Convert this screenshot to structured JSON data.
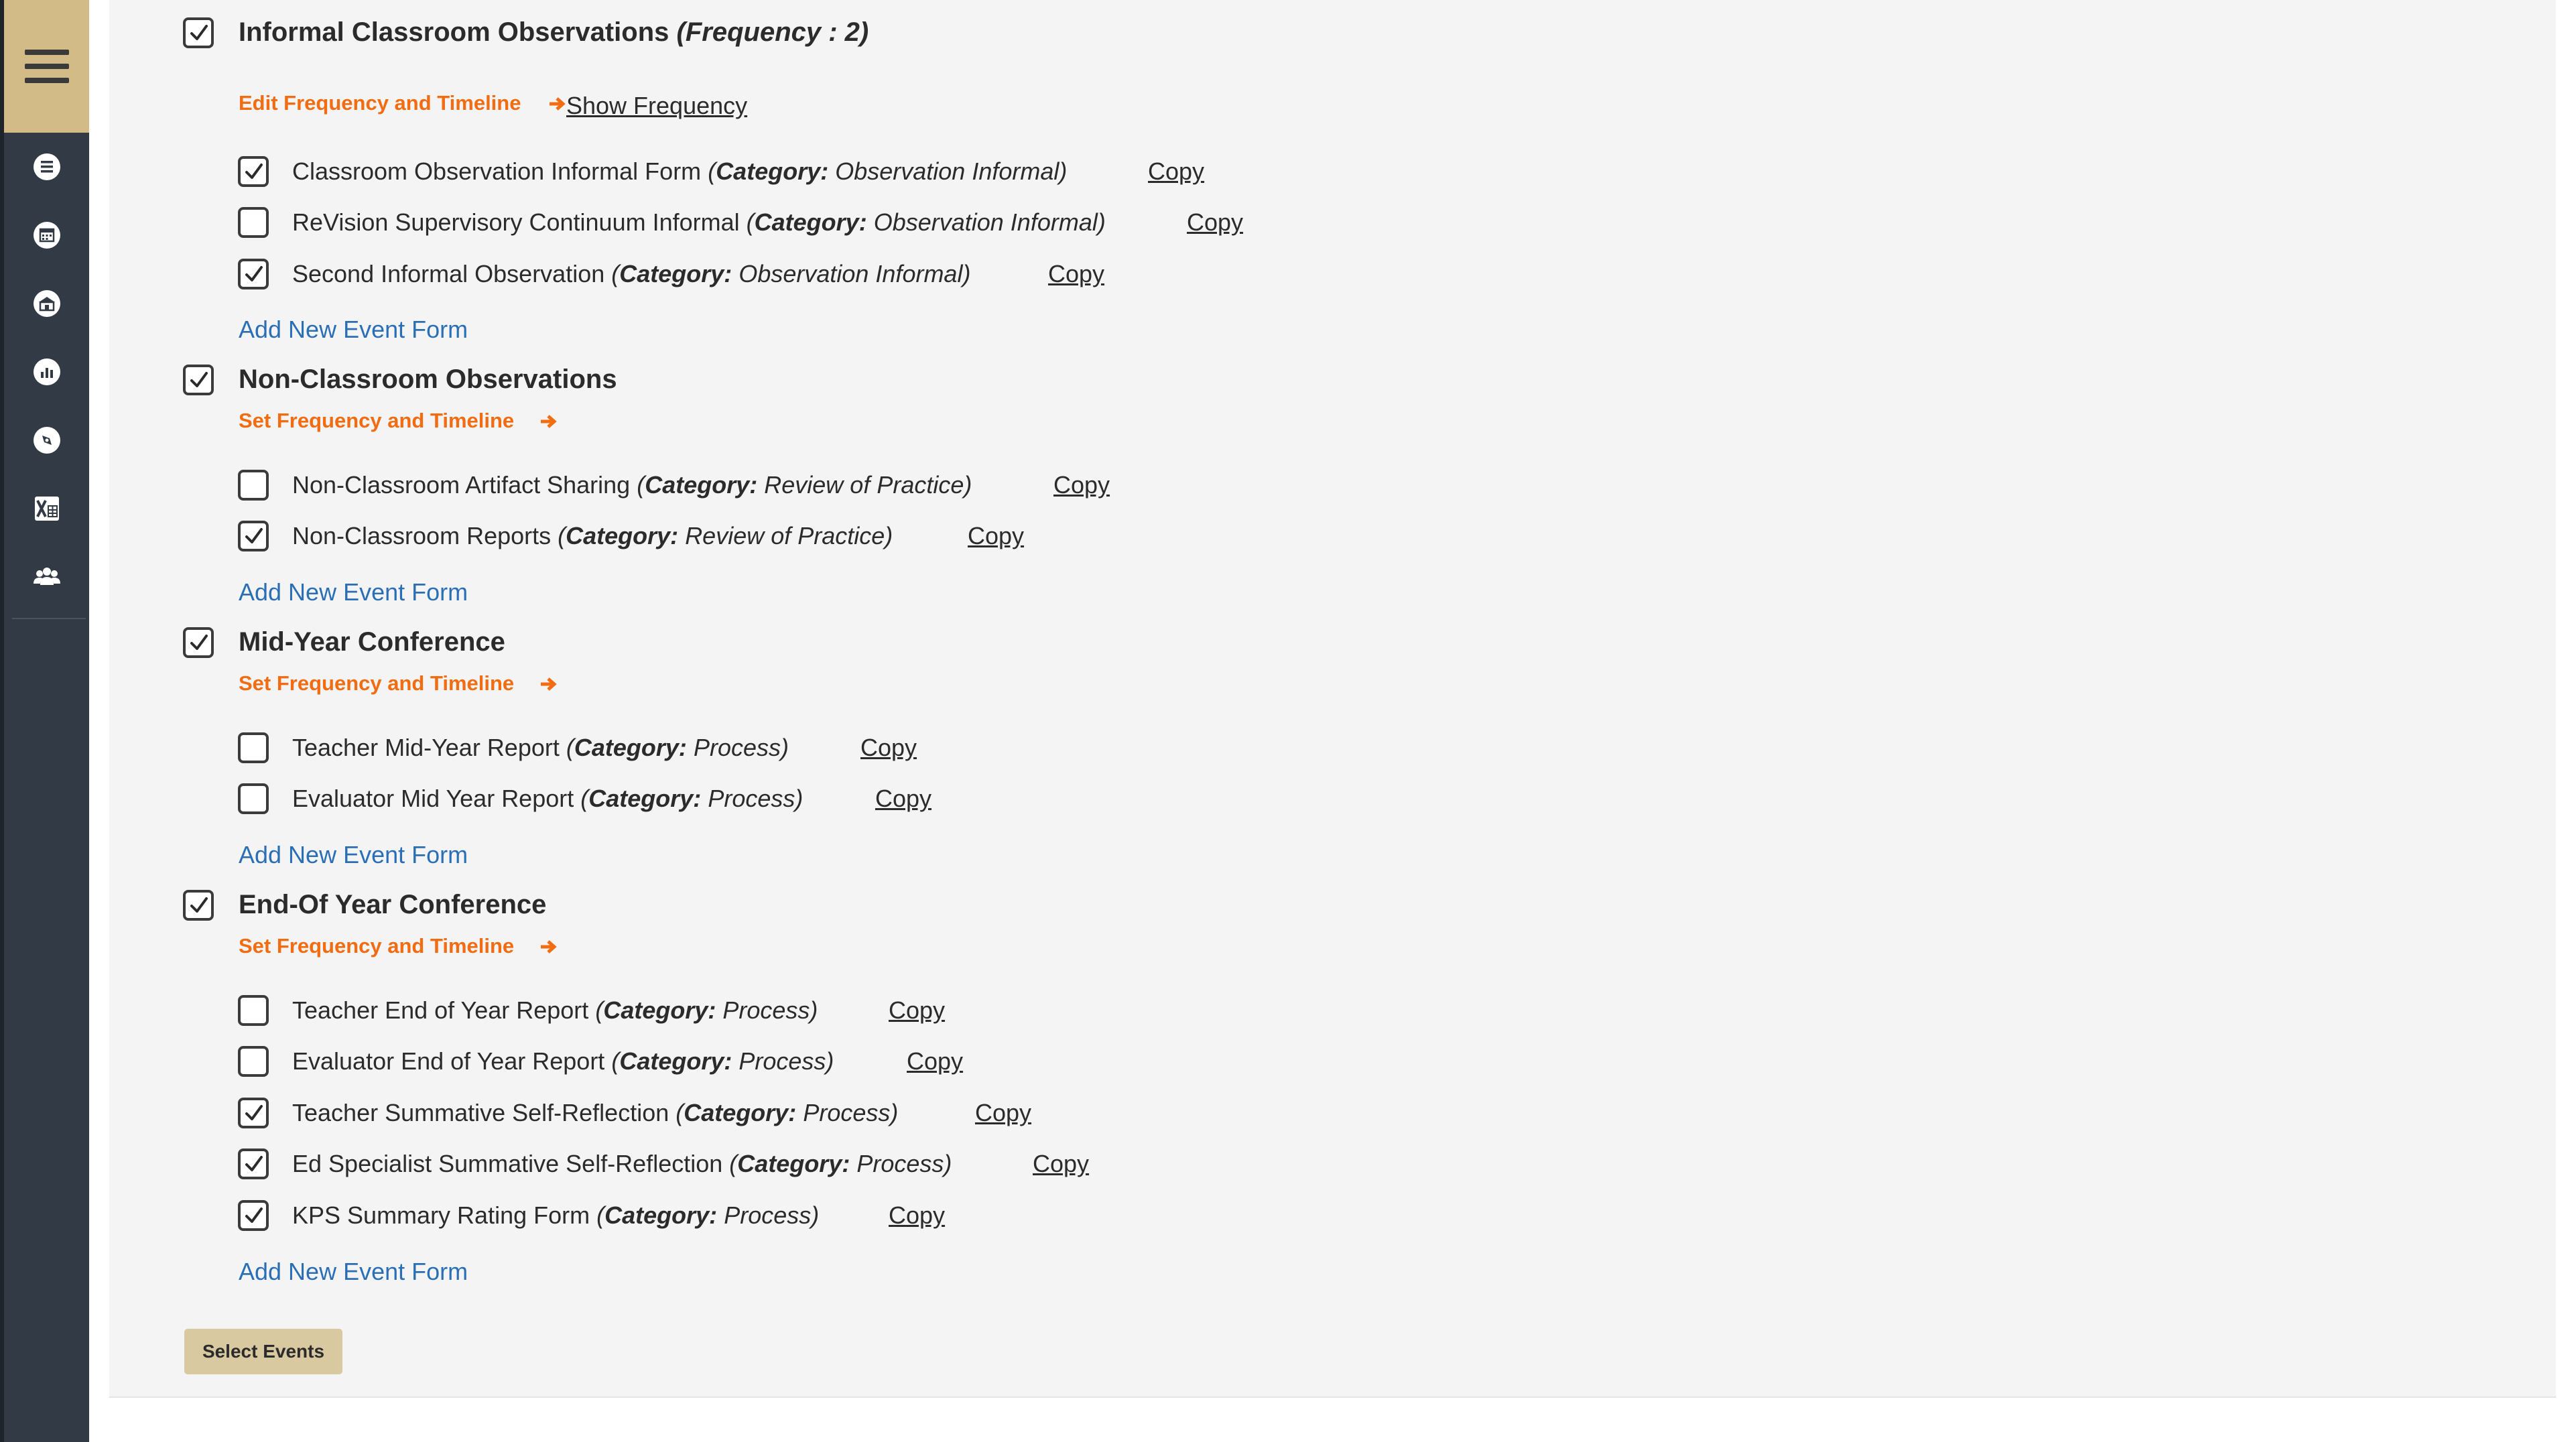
{
  "sidebar": {
    "menu_icon": "hamburger-menu-icon",
    "items": [
      {
        "icon": "list-icon"
      },
      {
        "icon": "calendar-icon"
      },
      {
        "icon": "school-icon"
      },
      {
        "icon": "bar-chart-icon"
      },
      {
        "icon": "compass-icon"
      },
      {
        "icon": "excel-icon"
      },
      {
        "icon": "users-icon"
      }
    ]
  },
  "colors": {
    "sidebar_bg": "#323a45",
    "sidebar_accent": "#d2bb86",
    "orange_link": "#f26c12",
    "blue_link": "#2a6fb5",
    "button_bg": "#d9c9a0"
  },
  "sections": [
    {
      "title": "Informal Classroom Observations",
      "frequency_text": "(Frequency : 2)",
      "checked": true,
      "frequency_link": "Edit Frequency and Timeline",
      "show_frequency": "Show Frequency",
      "forms": [
        {
          "name": "Classroom Observation Informal Form",
          "cat_label": "Category:",
          "cat_value": "Observation Informal",
          "checked": true,
          "copy": "Copy"
        },
        {
          "name": "ReVision Supervisory Continuum Informal",
          "cat_label": "Category:",
          "cat_value": "Observation Informal",
          "checked": false,
          "copy": "Copy"
        },
        {
          "name": "Second Informal Observation",
          "cat_label": "Category:",
          "cat_value": "Observation Informal",
          "checked": true,
          "copy": "Copy"
        }
      ],
      "add_link": "Add New Event Form"
    },
    {
      "title": "Non-Classroom Observations",
      "checked": true,
      "frequency_link": "Set Frequency and Timeline",
      "forms": [
        {
          "name": "Non-Classroom Artifact Sharing",
          "cat_label": "Category:",
          "cat_value": "Review of Practice",
          "checked": false,
          "copy": "Copy"
        },
        {
          "name": "Non-Classroom Reports",
          "cat_label": "Category:",
          "cat_value": "Review of Practice",
          "checked": true,
          "copy": "Copy"
        }
      ],
      "add_link": "Add New Event Form"
    },
    {
      "title": "Mid-Year Conference",
      "checked": true,
      "frequency_link": "Set Frequency and Timeline",
      "forms": [
        {
          "name": "Teacher Mid-Year Report",
          "cat_label": "Category:",
          "cat_value": "Process",
          "checked": false,
          "copy": "Copy"
        },
        {
          "name": "Evaluator Mid Year Report",
          "cat_label": "Category:",
          "cat_value": "Process",
          "checked": false,
          "copy": "Copy"
        }
      ],
      "add_link": "Add New Event Form"
    },
    {
      "title": "End-Of Year Conference",
      "checked": true,
      "frequency_link": "Set Frequency and Timeline",
      "forms": [
        {
          "name": "Teacher End of Year Report",
          "cat_label": "Category:",
          "cat_value": "Process",
          "checked": false,
          "copy": "Copy"
        },
        {
          "name": "Evaluator End of Year Report",
          "cat_label": "Category:",
          "cat_value": "Process",
          "checked": false,
          "copy": "Copy"
        },
        {
          "name": "Teacher Summative Self-Reflection",
          "cat_label": "Category:",
          "cat_value": "Process",
          "checked": true,
          "copy": "Copy"
        },
        {
          "name": "Ed Specialist Summative Self-Reflection",
          "cat_label": "Category:",
          "cat_value": "Process",
          "checked": true,
          "copy": "Copy"
        },
        {
          "name": "KPS Summary Rating Form",
          "cat_label": "Category:",
          "cat_value": "Process",
          "checked": true,
          "copy": "Copy"
        }
      ],
      "add_link": "Add New Event Form"
    }
  ],
  "select_button": "Select Events"
}
